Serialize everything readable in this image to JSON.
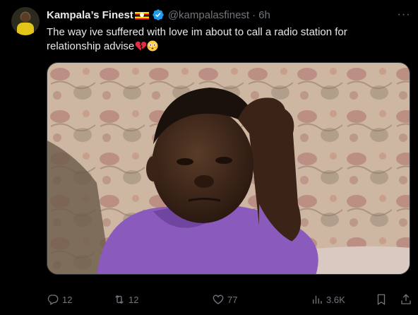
{
  "tweet": {
    "author_name": "Kampala’s Finest",
    "handle": "@kampalasfinest",
    "separator": "·",
    "time": "6h",
    "text": "The way ive suffered with love im about to call a radio station for relationship advise",
    "emojis": [
      "broken-heart-emoji",
      "flushed-face-emoji"
    ],
    "media_description_icon": "photo",
    "more_label": "···"
  },
  "actions": {
    "reply_count": "12",
    "retweet_count": "12",
    "like_count": "77",
    "views_count": "3.6K"
  },
  "colors": {
    "background": "#000000",
    "text_primary": "#e7e9ea",
    "text_secondary": "#71767b",
    "verified_blue": "#1d9bf0",
    "border": "#2f3336"
  }
}
